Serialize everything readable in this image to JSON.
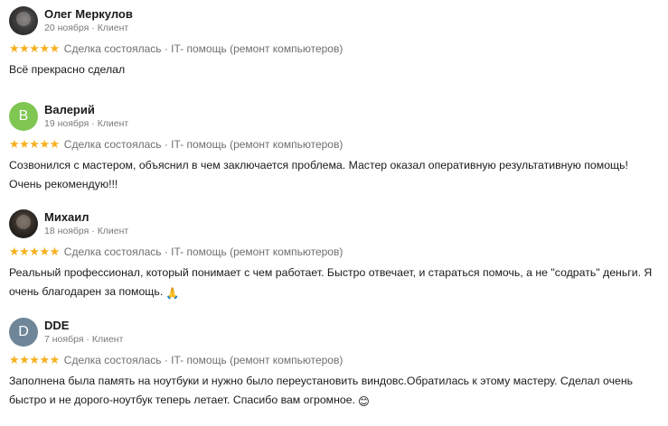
{
  "reviews": [
    {
      "name": "Олег Меркулов",
      "date": "20 ноября",
      "role": "Клиент",
      "avatar": {
        "type": "photo",
        "letter": ""
      },
      "stars": "★★★★★",
      "deal": "Сделка состоялась · IT- помощь (ремонт компьютеров)",
      "text": "Всё прекрасно сделал"
    },
    {
      "name": "Валерий",
      "date": "19 ноября",
      "role": "Клиент",
      "avatar": {
        "type": "letter",
        "letter": "В",
        "color": "#7fc653"
      },
      "stars": "★★★★★",
      "deal": "Сделка состоялась · IT- помощь (ремонт компьютеров)",
      "text_line1": "Созвонился с мастером, объяснил в чем заключается проблема. Мастер оказал оперативную результативную помощь!",
      "text_line2": "Очень рекомендую!!!"
    },
    {
      "name": "Михаил",
      "date": "18 ноября",
      "role": "Клиент",
      "avatar": {
        "type": "photo",
        "letter": ""
      },
      "stars": "★★★★★",
      "deal": "Сделка состоялась · IT- помощь (ремонт компьютеров)",
      "text_line1": "Реальный профессионал, который понимает с чем работает. Быстро отвечает, и стараться помочь, а не \"содрать\" деньги. Я",
      "text_line2": "очень благодарен за помощь.",
      "emoji": "🙏"
    },
    {
      "name": "DDE",
      "date": "7 ноября",
      "role": "Клиент",
      "avatar": {
        "type": "letter",
        "letter": "D",
        "color": "#6f8699"
      },
      "stars": "★★★★★",
      "deal": "Сделка состоялась · IT- помощь (ремонт компьютеров)",
      "text_line1": "Заполнена была память на ноутбуки и нужно было переустановить виндовс.Обратилась к этому мастеру. Сделал очень",
      "text_line2": "быстро и не дорого-ноутбук теперь летает. Спасибо вам огромное.",
      "emoji": "😊"
    }
  ],
  "separator": " · ",
  "colors": {
    "star": "#f6b01e",
    "muted": "#7a7a7a",
    "text": "#1a1a1a"
  }
}
